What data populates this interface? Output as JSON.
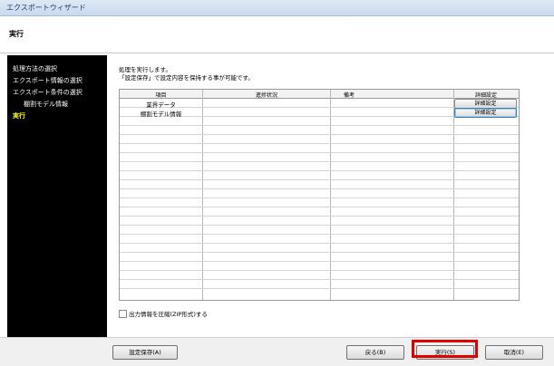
{
  "window": {
    "title": "エクスポートウィザード"
  },
  "header": {
    "step_title": "実行"
  },
  "sidebar": {
    "items": [
      {
        "label": "処理方法の選択",
        "active": false
      },
      {
        "label": "エクスポート情報の選択",
        "active": false
      },
      {
        "label": "エクスポート条件の選択",
        "active": false
      },
      {
        "label": "棚割モデル情報",
        "active": false
      },
      {
        "label": "実行",
        "active": true
      }
    ]
  },
  "main": {
    "description_line1": "処理を実行します。",
    "description_line2": "「設定保存」で設定内容を保持する事が可能です。",
    "table": {
      "columns": [
        "項目",
        "進捗状況",
        "備考",
        "詳細設定"
      ],
      "rows": [
        {
          "item": "業界データ",
          "progress": "",
          "note": "",
          "detail_button": "詳細設定"
        },
        {
          "item": "棚割モデル情報",
          "progress": "",
          "note": "",
          "detail_button": "詳細設定"
        }
      ]
    },
    "compress_checkbox": {
      "label": "出力情報を圧縮(ZIP形式)する",
      "checked": false
    }
  },
  "footer": {
    "save_settings_label": "設定保存(A)",
    "back_label": "戻る(B)",
    "execute_label": "実行(S)",
    "cancel_label": "取消(E)"
  },
  "colors": {
    "sidebar_bg": "#000000",
    "sidebar_text": "#ffffff",
    "sidebar_active": "#ffff00",
    "highlight": "#e00000"
  }
}
